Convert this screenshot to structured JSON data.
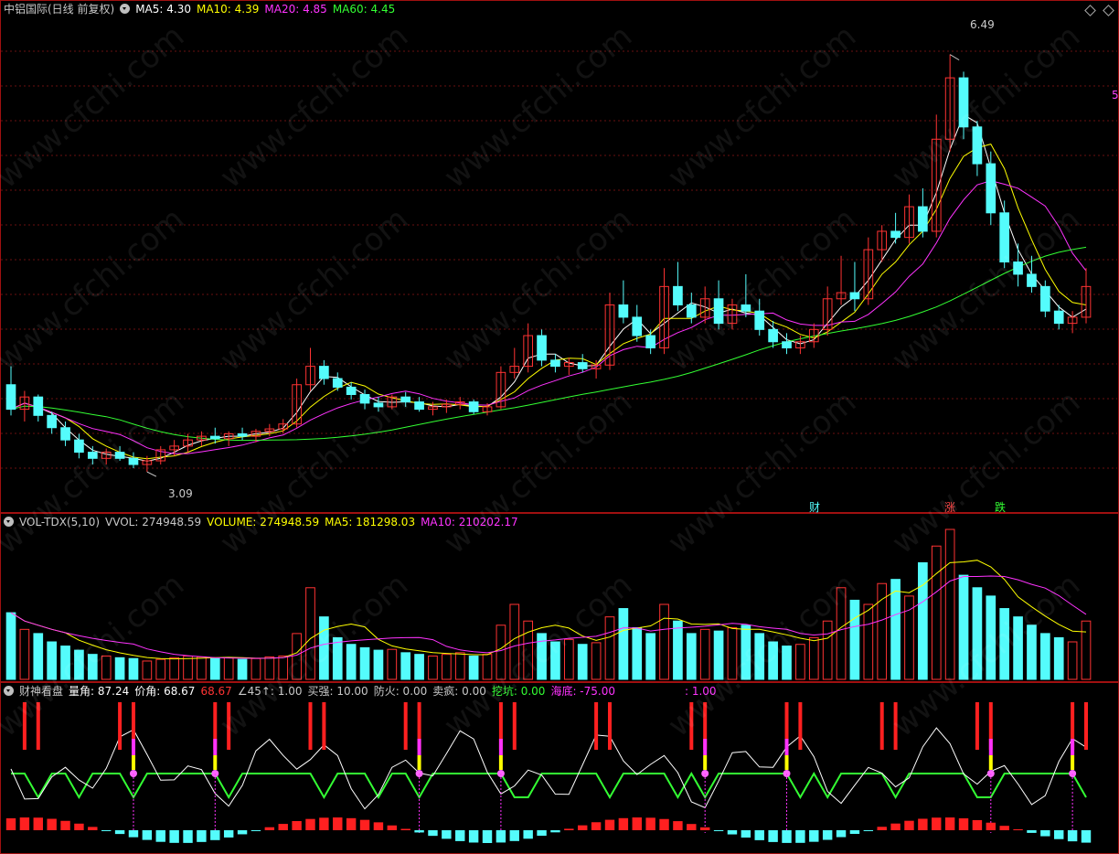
{
  "price_panel": {
    "title": "中铝国际(日线 前复权)",
    "ma5": "MA5: 4.30",
    "ma10": "MA10: 4.39",
    "ma20": "MA20: 4.85",
    "ma60": "MA60: 4.45",
    "high_label": "6.49",
    "low_label": "3.09",
    "right_edge_label": "5",
    "signal_cai": "财",
    "signal_zhang": "涨",
    "signal_die": "跌",
    "colors": {
      "ma5": "#ffffff",
      "ma10": "#ffff00",
      "ma20": "#ff33ff",
      "ma60": "#33ff33",
      "up": "#ff3333",
      "down": "#54fcfc"
    }
  },
  "volume_panel": {
    "name": "VOL-TDX(5,10)",
    "vvol": "VVOL: 274948.59",
    "volume": "VOLUME: 274948.59",
    "ma5": "MA5: 181298.03",
    "ma10": "MA10: 210202.17"
  },
  "indicator_panel": {
    "name": "财神看盘",
    "liangjiao": "量角: 87.24",
    "jiajiao": "价角: 68.67",
    "val3": "68.67",
    "val45": "∠45↑: 1.00",
    "maiqiang": "买强: 10.00",
    "fanghuo": "防火: 0.00",
    "maifeng": "卖疯: 0.00",
    "wakeng": "挖坑: 0.00",
    "haidi": "海底: -75.00",
    "val_last": ": 1.00"
  },
  "watermark": "www.cfchi.com",
  "chart_data": [
    {
      "type": "candlestick",
      "title": "中铝国际(日线 前复权)",
      "annotations": [
        "6.49",
        "3.09"
      ],
      "ylim": [
        2.8,
        6.8
      ],
      "ohlc": [
        [
          3.8,
          3.95,
          3.55,
          3.6
        ],
        [
          3.6,
          3.75,
          3.5,
          3.7
        ],
        [
          3.7,
          3.72,
          3.5,
          3.55
        ],
        [
          3.55,
          3.58,
          3.4,
          3.45
        ],
        [
          3.45,
          3.5,
          3.3,
          3.35
        ],
        [
          3.35,
          3.4,
          3.2,
          3.25
        ],
        [
          3.25,
          3.3,
          3.15,
          3.2
        ],
        [
          3.2,
          3.28,
          3.15,
          3.25
        ],
        [
          3.25,
          3.3,
          3.18,
          3.2
        ],
        [
          3.2,
          3.25,
          3.12,
          3.15
        ],
        [
          3.15,
          3.22,
          3.09,
          3.18
        ],
        [
          3.18,
          3.3,
          3.15,
          3.27
        ],
        [
          3.27,
          3.35,
          3.22,
          3.3
        ],
        [
          3.3,
          3.4,
          3.25,
          3.35
        ],
        [
          3.35,
          3.42,
          3.3,
          3.38
        ],
        [
          3.38,
          3.45,
          3.32,
          3.36
        ],
        [
          3.36,
          3.42,
          3.3,
          3.4
        ],
        [
          3.4,
          3.45,
          3.35,
          3.38
        ],
        [
          3.38,
          3.44,
          3.33,
          3.42
        ],
        [
          3.42,
          3.48,
          3.38,
          3.44
        ],
        [
          3.44,
          3.52,
          3.4,
          3.48
        ],
        [
          3.48,
          3.85,
          3.45,
          3.8
        ],
        [
          3.8,
          4.1,
          3.75,
          3.95
        ],
        [
          3.95,
          4.0,
          3.8,
          3.85
        ],
        [
          3.85,
          3.9,
          3.75,
          3.78
        ],
        [
          3.78,
          3.82,
          3.68,
          3.72
        ],
        [
          3.72,
          3.76,
          3.6,
          3.65
        ],
        [
          3.65,
          3.7,
          3.58,
          3.62
        ],
        [
          3.62,
          3.72,
          3.6,
          3.7
        ],
        [
          3.7,
          3.74,
          3.62,
          3.66
        ],
        [
          3.66,
          3.7,
          3.58,
          3.6
        ],
        [
          3.6,
          3.66,
          3.55,
          3.62
        ],
        [
          3.62,
          3.68,
          3.57,
          3.64
        ],
        [
          3.64,
          3.7,
          3.6,
          3.66
        ],
        [
          3.66,
          3.68,
          3.56,
          3.58
        ],
        [
          3.58,
          3.65,
          3.55,
          3.62
        ],
        [
          3.62,
          3.95,
          3.6,
          3.9
        ],
        [
          3.9,
          4.1,
          3.85,
          3.95
        ],
        [
          3.95,
          4.3,
          3.9,
          4.2
        ],
        [
          4.2,
          4.25,
          3.95,
          4.0
        ],
        [
          4.0,
          4.05,
          3.9,
          3.95
        ],
        [
          3.95,
          4.02,
          3.88,
          3.98
        ],
        [
          3.98,
          4.05,
          3.9,
          3.93
        ],
        [
          3.93,
          4.0,
          3.85,
          3.96
        ],
        [
          3.96,
          4.55,
          3.92,
          4.45
        ],
        [
          4.45,
          4.65,
          4.3,
          4.35
        ],
        [
          4.35,
          4.45,
          4.15,
          4.2
        ],
        [
          4.2,
          4.25,
          4.05,
          4.1
        ],
        [
          4.1,
          4.75,
          4.05,
          4.6
        ],
        [
          4.6,
          4.8,
          4.4,
          4.45
        ],
        [
          4.45,
          4.55,
          4.3,
          4.35
        ],
        [
          4.35,
          4.6,
          4.3,
          4.5
        ],
        [
          4.5,
          4.65,
          4.25,
          4.3
        ],
        [
          4.3,
          4.5,
          4.25,
          4.45
        ],
        [
          4.45,
          4.7,
          4.35,
          4.4
        ],
        [
          4.4,
          4.5,
          4.2,
          4.25
        ],
        [
          4.25,
          4.32,
          4.1,
          4.15
        ],
        [
          4.15,
          4.22,
          4.05,
          4.1
        ],
        [
          4.1,
          4.2,
          4.05,
          4.15
        ],
        [
          4.15,
          4.3,
          4.1,
          4.25
        ],
        [
          4.25,
          4.6,
          4.2,
          4.5
        ],
        [
          4.5,
          4.85,
          4.45,
          4.55
        ],
        [
          4.55,
          4.8,
          4.4,
          4.5
        ],
        [
          4.5,
          5.0,
          4.45,
          4.9
        ],
        [
          4.9,
          5.1,
          4.8,
          5.05
        ],
        [
          5.05,
          5.2,
          4.95,
          5.0
        ],
        [
          5.0,
          5.35,
          4.95,
          5.25
        ],
        [
          5.25,
          5.4,
          5.0,
          5.05
        ],
        [
          5.05,
          6.0,
          5.0,
          5.8
        ],
        [
          5.8,
          6.49,
          5.7,
          6.3
        ],
        [
          6.3,
          6.35,
          5.8,
          5.9
        ],
        [
          5.9,
          5.95,
          5.5,
          5.6
        ],
        [
          5.6,
          5.7,
          5.1,
          5.2
        ],
        [
          5.2,
          5.3,
          4.75,
          4.8
        ],
        [
          4.8,
          4.95,
          4.6,
          4.7
        ],
        [
          4.7,
          4.85,
          4.55,
          4.6
        ],
        [
          4.6,
          4.65,
          4.35,
          4.4
        ],
        [
          4.4,
          4.45,
          4.25,
          4.3
        ],
        [
          4.3,
          4.4,
          4.22,
          4.35
        ],
        [
          4.35,
          4.75,
          4.3,
          4.6
        ]
      ]
    },
    {
      "type": "bar",
      "title": "VOL-TDX(5,10)",
      "values": [
        80,
        60,
        55,
        45,
        40,
        35,
        30,
        28,
        26,
        25,
        22,
        24,
        26,
        28,
        27,
        25,
        26,
        24,
        25,
        27,
        28,
        55,
        110,
        75,
        50,
        42,
        38,
        35,
        36,
        32,
        30,
        28,
        30,
        32,
        28,
        30,
        65,
        90,
        70,
        55,
        45,
        48,
        42,
        44,
        75,
        85,
        62,
        55,
        90,
        70,
        55,
        60,
        58,
        62,
        65,
        55,
        45,
        40,
        42,
        50,
        70,
        110,
        95,
        90,
        115,
        120,
        100,
        140,
        160,
        180,
        125,
        110,
        100,
        85,
        75,
        65,
        55,
        50,
        45,
        70
      ],
      "series": [
        {
          "name": "MA5"
        },
        {
          "name": "MA10"
        }
      ]
    }
  ]
}
